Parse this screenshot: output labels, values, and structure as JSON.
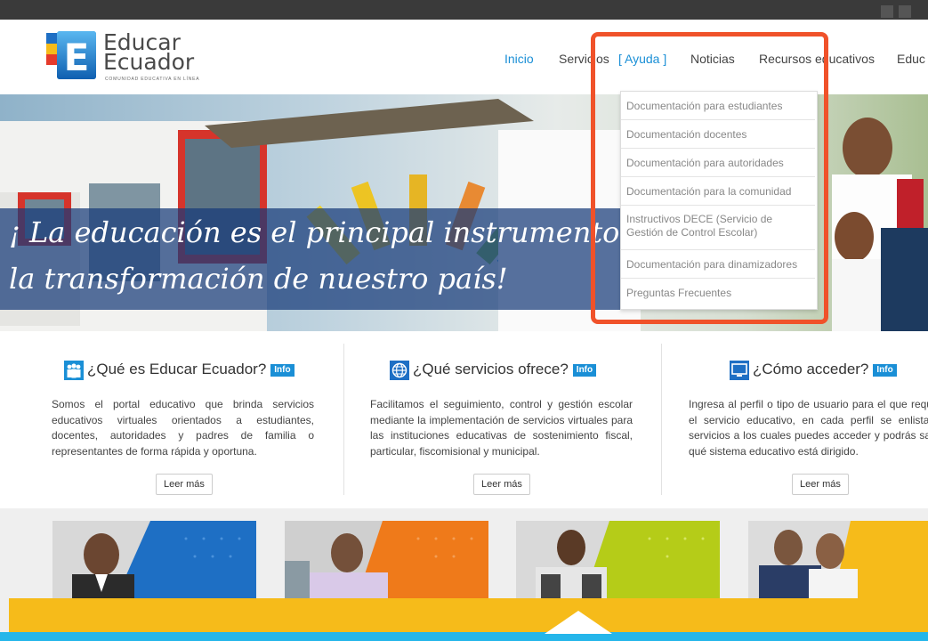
{
  "logo": {
    "line1": "Educar",
    "line2": "Ecuador",
    "tagline": "COMUNIDAD EDUCATIVA EN LÍNEA",
    "mark_letter": "E"
  },
  "nav": [
    {
      "label": "Inicio",
      "active": true
    },
    {
      "label": "Servicios"
    },
    {
      "label": "[  Ayuda  ]",
      "highlighted": true
    },
    {
      "label": "Noticias"
    },
    {
      "label": "Recursos educativos"
    },
    {
      "label": "Educ"
    }
  ],
  "hero": {
    "line1": "¡ La educación es el principal instrumento",
    "line2": "la transformación de nuestro país!"
  },
  "dropdown": {
    "items": [
      "Documentación para estudiantes",
      "Documentación docentes",
      "Documentación para autoridades",
      "Documentación para la comunidad",
      "Instructivos DECE (Servicio de Gestión de Control Escolar)",
      "Documentación para dinamizadores",
      "Preguntas Frecuentes"
    ]
  },
  "columns": [
    {
      "title": "¿Qué es Educar Ecuador?",
      "badge": "Info",
      "icon": "people-icon",
      "text": "Somos el portal educativo que brinda servicios educativos virtuales orientados a estudiantes, docentes, autoridades y padres de familia o representantes de forma rápida y oportuna.",
      "button": "Leer más"
    },
    {
      "title": "¿Qué servicios ofrece?",
      "badge": "Info",
      "icon": "globe-icon",
      "text": "Facilitamos el seguimiento, control y gestión escolar mediante la implementación de servicios virtuales para las instituciones educativas de sostenimiento fiscal, particular, fiscomisional y municipal.",
      "button": "Leer más"
    },
    {
      "title": "¿Cómo acceder?",
      "badge": "Info",
      "icon": "monitor-icon",
      "text": "Ingresa al perfil o tipo de usuario para el que requieres el servicio educativo, en cada perfil se enlistan los servicios a los cuales puedes acceder y podrás saber a qué sistema educativo está dirigido.",
      "button": "Leer más"
    }
  ],
  "colors": {
    "accent_blue": "#1a8fd6",
    "highlight_orange": "#f0522a",
    "card_blue": "#1e6fc4",
    "card_orange": "#ef7a1a",
    "card_green": "#b5cc18",
    "card_yellow": "#f6bb1a",
    "footer_yellow": "#f6bb1a",
    "footer_blue": "#25b6ea"
  }
}
